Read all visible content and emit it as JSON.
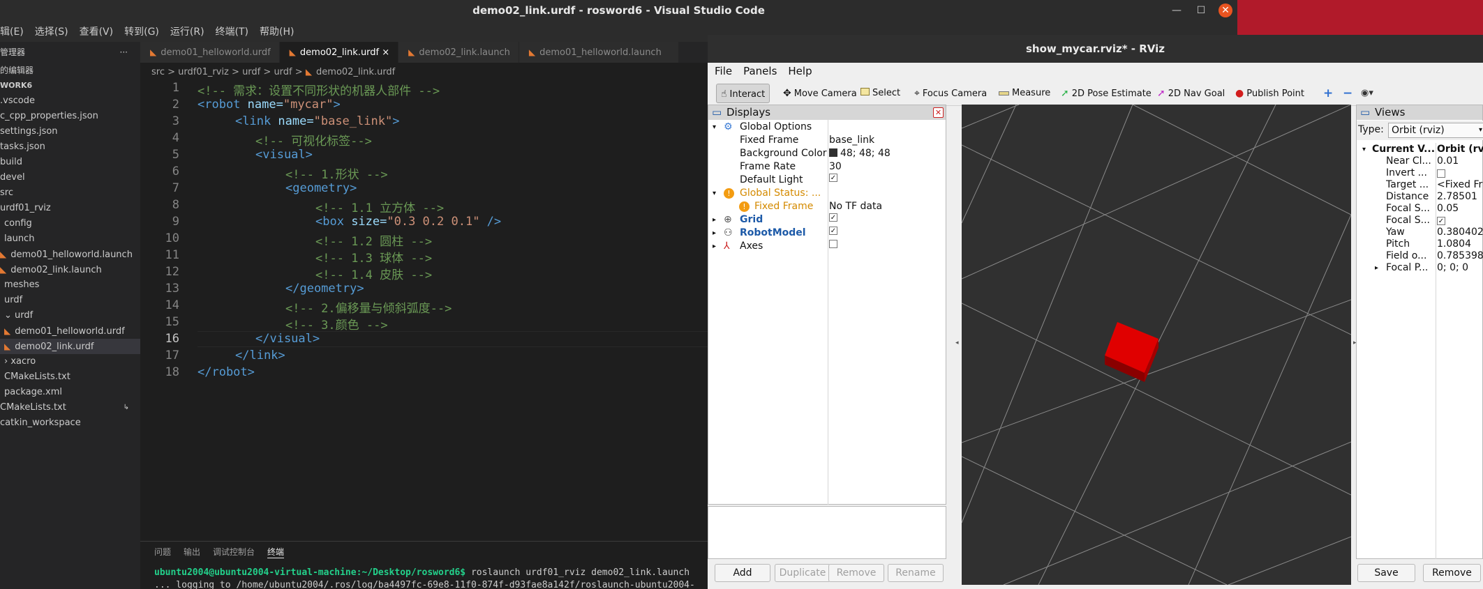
{
  "vscode": {
    "title": "demo02_link.urdf - rosword6 - Visual Studio Code",
    "menu": [
      "辑(E)",
      "选择(S)",
      "查看(V)",
      "转到(G)",
      "运行(R)",
      "终端(T)",
      "帮助(H)"
    ],
    "sidebar": {
      "header": "管理器",
      "header_more": "···",
      "open_editors": "的编辑器",
      "workspace": "WORK6",
      "items": [
        ".vscode",
        "c_cpp_properties.json",
        "settings.json",
        "tasks.json",
        "build",
        "devel",
        "src",
        "urdf01_rviz",
        "config",
        "launch",
        "demo01_helloworld.launch",
        "demo02_link.launch",
        "meshes",
        "urdf",
        "urdf",
        "demo01_helloworld.urdf",
        "demo02_link.urdf",
        "xacro",
        "CMakeLists.txt",
        "package.xml",
        "CMakeLists.txt",
        "catkin_workspace"
      ]
    },
    "tabs": [
      {
        "label": "demo01_helloworld.urdf"
      },
      {
        "label": "demo02_link.urdf",
        "close": "×"
      },
      {
        "label": "demo02_link.launch"
      },
      {
        "label": "demo01_helloworld.launch"
      }
    ],
    "breadcrumb": {
      "src": "src",
      "p1": "urdf01_rviz",
      "p2": "urdf",
      "p3": "urdf",
      "file": "demo02_link.urdf",
      "sep": ">"
    },
    "line_numbers": [
      "1",
      "2",
      "3",
      "4",
      "5",
      "6",
      "7",
      "8",
      "9",
      "10",
      "11",
      "12",
      "13",
      "14",
      "15",
      "16",
      "17",
      "18"
    ],
    "code": {
      "l1": "<!-- 需求：设置不同形状的机器人部件 -->",
      "l2_tag": "<robot",
      "l2_attr": " name=",
      "l2_val": "\"mycar\"",
      "l2_end": ">",
      "l3_tag": "<link",
      "l3_attr": " name=",
      "l3_val": "\"base_link\"",
      "l3_end": ">",
      "l4": "<!-- 可视化标签-->",
      "l5": "<visual>",
      "l6": "<!-- 1.形状 -->",
      "l7": "<geometry>",
      "l8": "<!-- 1.1 立方体 -->",
      "l9_tag": "<box",
      "l9_attr": " size=",
      "l9_val": "\"0.3 0.2 0.1\"",
      "l9_end": " />",
      "l10": "<!-- 1.2 圆柱 -->",
      "l11": "<!-- 1.3 球体 -->",
      "l12": "<!-- 1.4 皮肤 -->",
      "l13": "</geometry>",
      "l14": "<!-- 2.偏移量与倾斜弧度-->",
      "l15": "<!-- 3.颜色 -->",
      "l16": "</visual>",
      "l17": "</link>",
      "l18": "</robot>"
    },
    "panel": {
      "tabs": [
        "问题",
        "输出",
        "调试控制台",
        "终端"
      ],
      "prompt": "ubuntu2004@ubuntu2004-virtual-machine:~/Desktop/rosword6$",
      "command": " roslaunch urdf01_rviz demo02_link.launch",
      "log": "... logging to /home/ubuntu2004/.ros/log/ba4497fc-69e8-11f0-874f-d93fae8a142f/roslaunch-ubuntu2004-"
    }
  },
  "rviz": {
    "title": "show_mycar.rviz* - RViz",
    "menu": [
      "File",
      "Panels",
      "Help"
    ],
    "toolbar": {
      "interact": "Interact",
      "move_camera": "Move Camera",
      "select": "Select",
      "focus_camera": "Focus Camera",
      "measure": "Measure",
      "pose_estimate": "2D Pose Estimate",
      "nav_goal": "2D Nav Goal",
      "publish_point": "Publish Point"
    },
    "displays": {
      "title": "Displays",
      "global_options": "Global Options",
      "fixed_frame_label": "Fixed Frame",
      "fixed_frame": "base_link",
      "bg_label": "Background Color",
      "bg": "48; 48; 48",
      "frame_rate_label": "Frame Rate",
      "frame_rate": "30",
      "default_light_label": "Default Light",
      "global_status": "Global Status: ...",
      "fixed_frame_err": "Fixed Frame",
      "fixed_frame_err_val": "No TF data",
      "grid": "Grid",
      "robot_model": "RobotModel",
      "axes": "Axes",
      "buttons": [
        "Add",
        "Duplicate",
        "Remove",
        "Rename"
      ]
    },
    "views": {
      "title": "Views",
      "type_label": "Type:",
      "type_value": "Orbit (rviz)",
      "rows": [
        {
          "name": "Current V...",
          "value": "Orbit (rviz"
        },
        {
          "name": "Near Cl...",
          "value": "0.01"
        },
        {
          "name": "Invert ...",
          "value": ""
        },
        {
          "name": "Target ...",
          "value": "<Fixed Fra"
        },
        {
          "name": "Distance",
          "value": "2.78501"
        },
        {
          "name": "Focal S...",
          "value": "0.05"
        },
        {
          "name": "Focal S...",
          "value": ""
        },
        {
          "name": "Yaw",
          "value": "0.380402"
        },
        {
          "name": "Pitch",
          "value": "1.0804"
        },
        {
          "name": "Field o...",
          "value": "0.785398"
        },
        {
          "name": "Focal P...",
          "value": "0; 0; 0"
        }
      ],
      "buttons": [
        "Save",
        "Remove"
      ]
    }
  }
}
